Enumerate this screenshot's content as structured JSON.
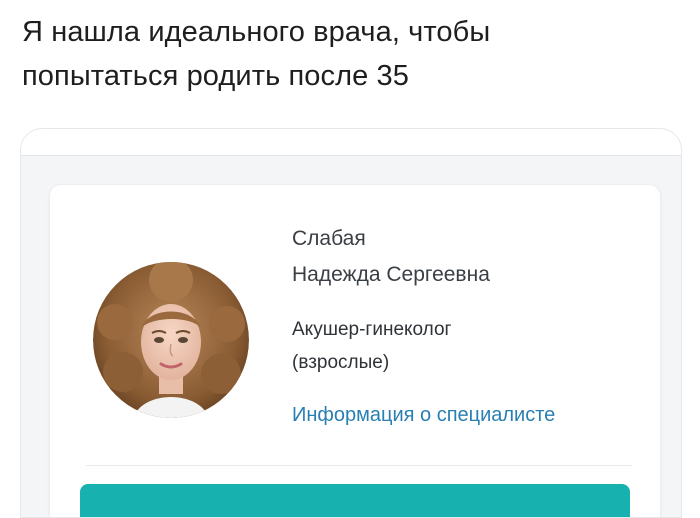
{
  "caption": {
    "line1": "Я нашла идеального врача, чтобы",
    "line2": "попытаться родить после 35"
  },
  "doctor": {
    "last_name": "Слабая",
    "full_name": "Надежда Сергеевна",
    "specialty": "Акушер-гинеколог",
    "specialty_note": "(взрослые)",
    "info_link": "Информация о специалисте"
  },
  "colors": {
    "link": "#2a7fb2",
    "accent_button": "#17b2b0"
  },
  "icons": {
    "avatar": "doctor-avatar-photo"
  }
}
